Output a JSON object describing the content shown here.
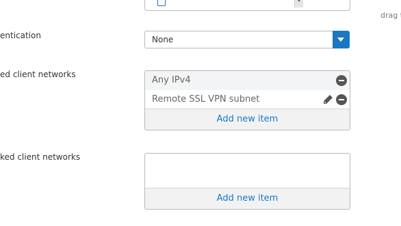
{
  "top": {
    "drag_hint": "drag t"
  },
  "authentication": {
    "label": "entication",
    "value": "None"
  },
  "permitted_networks": {
    "label": "ed client networks",
    "items": [
      {
        "text": "Any IPv4"
      },
      {
        "text": "Remote SSL VPN subnet"
      }
    ],
    "add_label": "Add new item"
  },
  "blocked_networks": {
    "label": "ked client networks",
    "add_label": "Add new item"
  },
  "colors": {
    "accent": "#1a78c2",
    "border": "#b8b8b8",
    "icon": "#555555"
  },
  "icons": {
    "dropdown": "chevron-down-icon",
    "remove": "minus-circle-icon",
    "edit": "pencil-icon"
  }
}
